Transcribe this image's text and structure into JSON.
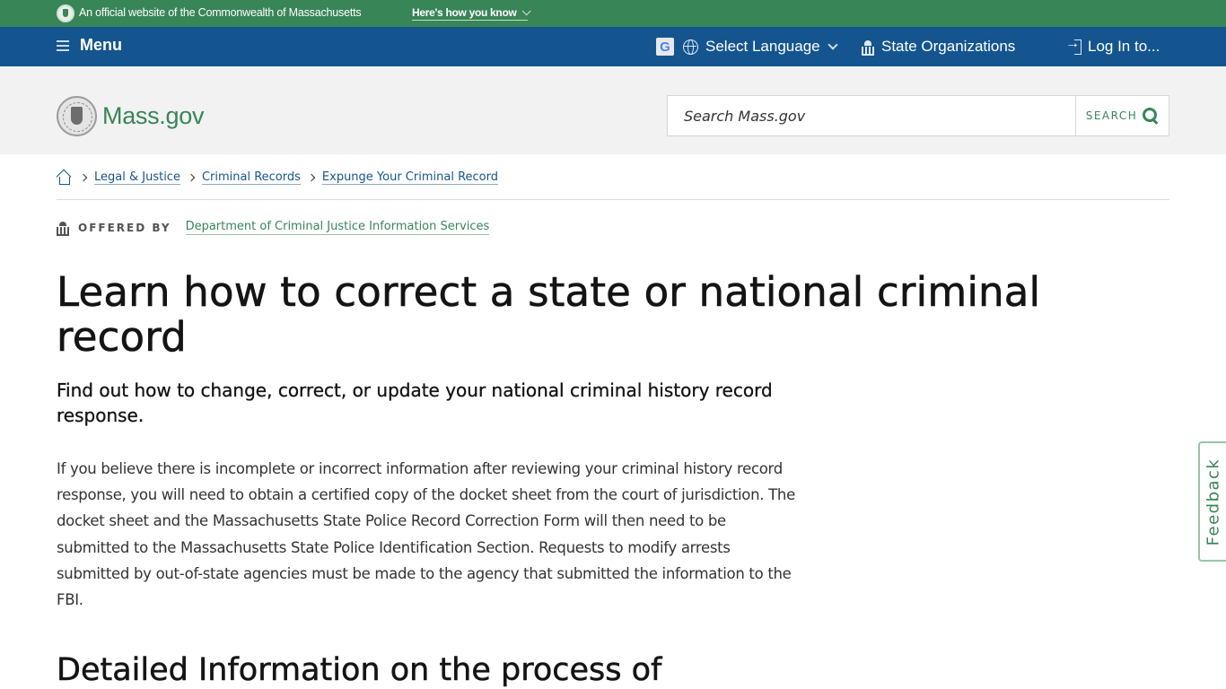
{
  "official_banner": {
    "text": "An official website of the Commonwealth of Massachusetts",
    "how_you_know_label": "Here's how you know"
  },
  "nav": {
    "menu_label": "Menu",
    "google_icon_glyph": "G",
    "language_label": "Select Language",
    "state_orgs_label": "State Organizations",
    "login_label": "Log In to..."
  },
  "header": {
    "logo_text": "Mass.gov",
    "search_placeholder": "Search Mass.gov",
    "search_button_label": "SEARCH"
  },
  "breadcrumb": {
    "items": [
      {
        "label": "Legal & Justice"
      },
      {
        "label": "Criminal Records"
      },
      {
        "label": "Expunge Your Criminal Record"
      }
    ]
  },
  "offered_by": {
    "label": "OFFERED BY",
    "organization": "Department of Criminal Justice Information Services"
  },
  "page": {
    "title": "Learn how to correct a state or national criminal record",
    "lede": "Find out how to change, correct, or update your national criminal history record response.",
    "body": "If you believe there is incomplete or incorrect information after reviewing your criminal history record response, you will need to obtain a certified copy of the docket sheet from the court of jurisdiction. The docket sheet and the Massachusetts State Police Record Correction Form will then need to be submitted to the Massachusetts State Police Identification Section.  Requests to modify arrests submitted by out-of-state agencies must be made to the agency that submitted the information to the FBI.",
    "section_heading": "Detailed Information on the process of"
  },
  "feedback_label": "Feedback",
  "colors": {
    "official_green": "#388557",
    "nav_blue": "#14558f",
    "header_gray": "#f2f2f2"
  }
}
